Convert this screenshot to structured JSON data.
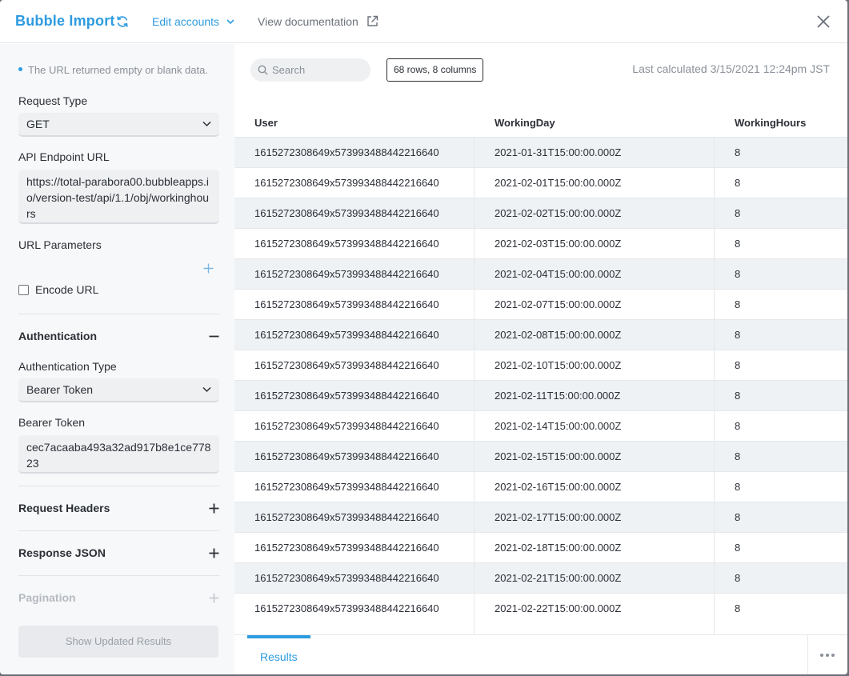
{
  "header": {
    "title": "Bubble Import",
    "edit_accounts": "Edit accounts",
    "view_documentation": "View documentation"
  },
  "left": {
    "warning": "The URL returned empty or blank data.",
    "request_type_label": "Request Type",
    "request_type_value": "GET",
    "endpoint_label": "API Endpoint URL",
    "endpoint_value": "https://total-parabora00.bubbleapps.io/version-test/api/1.1/obj/workinghours",
    "url_params_label": "URL Parameters",
    "encode_url_label": "Encode URL",
    "encode_url_checked": false,
    "authentication_label": "Authentication",
    "auth_type_label": "Authentication Type",
    "auth_type_value": "Bearer Token",
    "bearer_token_label": "Bearer Token",
    "bearer_token_value": "cec7acaaba493a32ad917b8e1ce77823",
    "request_headers_label": "Request Headers",
    "response_json_label": "Response JSON",
    "pagination_label": "Pagination",
    "show_results_button": "Show Updated Results"
  },
  "right": {
    "search_placeholder": "Search",
    "rows_badge": "68 rows, 8 columns",
    "last_calculated": "Last calculated 3/15/2021 12:24pm JST",
    "columns": [
      "User",
      "WorkingDay",
      "WorkingHours"
    ],
    "rows": [
      [
        "1615272308649x573993488442216640",
        "2021-01-31T15:00:00.000Z",
        "8"
      ],
      [
        "1615272308649x573993488442216640",
        "2021-02-01T15:00:00.000Z",
        "8"
      ],
      [
        "1615272308649x573993488442216640",
        "2021-02-02T15:00:00.000Z",
        "8"
      ],
      [
        "1615272308649x573993488442216640",
        "2021-02-03T15:00:00.000Z",
        "8"
      ],
      [
        "1615272308649x573993488442216640",
        "2021-02-04T15:00:00.000Z",
        "8"
      ],
      [
        "1615272308649x573993488442216640",
        "2021-02-07T15:00:00.000Z",
        "8"
      ],
      [
        "1615272308649x573993488442216640",
        "2021-02-08T15:00:00.000Z",
        "8"
      ],
      [
        "1615272308649x573993488442216640",
        "2021-02-10T15:00:00.000Z",
        "8"
      ],
      [
        "1615272308649x573993488442216640",
        "2021-02-11T15:00:00.000Z",
        "8"
      ],
      [
        "1615272308649x573993488442216640",
        "2021-02-14T15:00:00.000Z",
        "8"
      ],
      [
        "1615272308649x573993488442216640",
        "2021-02-15T15:00:00.000Z",
        "8"
      ],
      [
        "1615272308649x573993488442216640",
        "2021-02-16T15:00:00.000Z",
        "8"
      ],
      [
        "1615272308649x573993488442216640",
        "2021-02-17T15:00:00.000Z",
        "8"
      ],
      [
        "1615272308649x573993488442216640",
        "2021-02-18T15:00:00.000Z",
        "8"
      ],
      [
        "1615272308649x573993488442216640",
        "2021-02-21T15:00:00.000Z",
        "8"
      ],
      [
        "1615272308649x573993488442216640",
        "2021-02-22T15:00:00.000Z",
        "8"
      ]
    ],
    "results_tab": "Results"
  },
  "colors": {
    "accent": "#2d9be0",
    "row_alt": "#eef2f5",
    "panel_bg": "#f7f8f9"
  }
}
